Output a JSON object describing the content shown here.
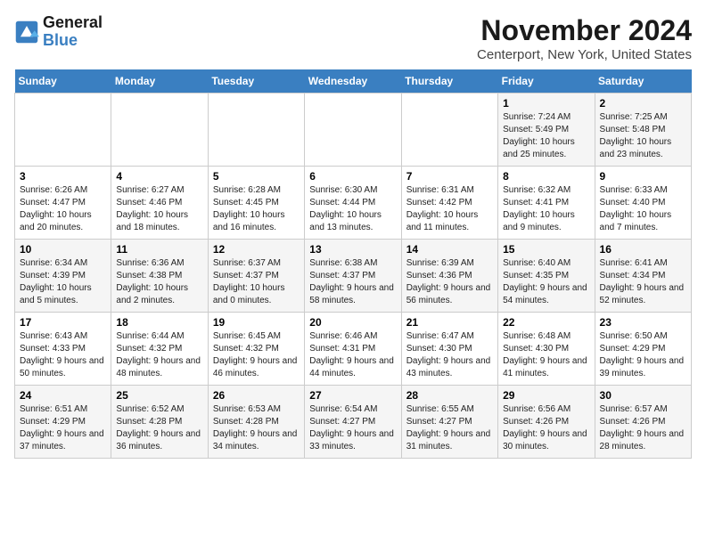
{
  "header": {
    "logo_line1": "General",
    "logo_line2": "Blue",
    "month": "November 2024",
    "location": "Centerport, New York, United States"
  },
  "weekdays": [
    "Sunday",
    "Monday",
    "Tuesday",
    "Wednesday",
    "Thursday",
    "Friday",
    "Saturday"
  ],
  "weeks": [
    [
      {
        "day": "",
        "info": ""
      },
      {
        "day": "",
        "info": ""
      },
      {
        "day": "",
        "info": ""
      },
      {
        "day": "",
        "info": ""
      },
      {
        "day": "",
        "info": ""
      },
      {
        "day": "1",
        "info": "Sunrise: 7:24 AM\nSunset: 5:49 PM\nDaylight: 10 hours and 25 minutes."
      },
      {
        "day": "2",
        "info": "Sunrise: 7:25 AM\nSunset: 5:48 PM\nDaylight: 10 hours and 23 minutes."
      }
    ],
    [
      {
        "day": "3",
        "info": "Sunrise: 6:26 AM\nSunset: 4:47 PM\nDaylight: 10 hours and 20 minutes."
      },
      {
        "day": "4",
        "info": "Sunrise: 6:27 AM\nSunset: 4:46 PM\nDaylight: 10 hours and 18 minutes."
      },
      {
        "day": "5",
        "info": "Sunrise: 6:28 AM\nSunset: 4:45 PM\nDaylight: 10 hours and 16 minutes."
      },
      {
        "day": "6",
        "info": "Sunrise: 6:30 AM\nSunset: 4:44 PM\nDaylight: 10 hours and 13 minutes."
      },
      {
        "day": "7",
        "info": "Sunrise: 6:31 AM\nSunset: 4:42 PM\nDaylight: 10 hours and 11 minutes."
      },
      {
        "day": "8",
        "info": "Sunrise: 6:32 AM\nSunset: 4:41 PM\nDaylight: 10 hours and 9 minutes."
      },
      {
        "day": "9",
        "info": "Sunrise: 6:33 AM\nSunset: 4:40 PM\nDaylight: 10 hours and 7 minutes."
      }
    ],
    [
      {
        "day": "10",
        "info": "Sunrise: 6:34 AM\nSunset: 4:39 PM\nDaylight: 10 hours and 5 minutes."
      },
      {
        "day": "11",
        "info": "Sunrise: 6:36 AM\nSunset: 4:38 PM\nDaylight: 10 hours and 2 minutes."
      },
      {
        "day": "12",
        "info": "Sunrise: 6:37 AM\nSunset: 4:37 PM\nDaylight: 10 hours and 0 minutes."
      },
      {
        "day": "13",
        "info": "Sunrise: 6:38 AM\nSunset: 4:37 PM\nDaylight: 9 hours and 58 minutes."
      },
      {
        "day": "14",
        "info": "Sunrise: 6:39 AM\nSunset: 4:36 PM\nDaylight: 9 hours and 56 minutes."
      },
      {
        "day": "15",
        "info": "Sunrise: 6:40 AM\nSunset: 4:35 PM\nDaylight: 9 hours and 54 minutes."
      },
      {
        "day": "16",
        "info": "Sunrise: 6:41 AM\nSunset: 4:34 PM\nDaylight: 9 hours and 52 minutes."
      }
    ],
    [
      {
        "day": "17",
        "info": "Sunrise: 6:43 AM\nSunset: 4:33 PM\nDaylight: 9 hours and 50 minutes."
      },
      {
        "day": "18",
        "info": "Sunrise: 6:44 AM\nSunset: 4:32 PM\nDaylight: 9 hours and 48 minutes."
      },
      {
        "day": "19",
        "info": "Sunrise: 6:45 AM\nSunset: 4:32 PM\nDaylight: 9 hours and 46 minutes."
      },
      {
        "day": "20",
        "info": "Sunrise: 6:46 AM\nSunset: 4:31 PM\nDaylight: 9 hours and 44 minutes."
      },
      {
        "day": "21",
        "info": "Sunrise: 6:47 AM\nSunset: 4:30 PM\nDaylight: 9 hours and 43 minutes."
      },
      {
        "day": "22",
        "info": "Sunrise: 6:48 AM\nSunset: 4:30 PM\nDaylight: 9 hours and 41 minutes."
      },
      {
        "day": "23",
        "info": "Sunrise: 6:50 AM\nSunset: 4:29 PM\nDaylight: 9 hours and 39 minutes."
      }
    ],
    [
      {
        "day": "24",
        "info": "Sunrise: 6:51 AM\nSunset: 4:29 PM\nDaylight: 9 hours and 37 minutes."
      },
      {
        "day": "25",
        "info": "Sunrise: 6:52 AM\nSunset: 4:28 PM\nDaylight: 9 hours and 36 minutes."
      },
      {
        "day": "26",
        "info": "Sunrise: 6:53 AM\nSunset: 4:28 PM\nDaylight: 9 hours and 34 minutes."
      },
      {
        "day": "27",
        "info": "Sunrise: 6:54 AM\nSunset: 4:27 PM\nDaylight: 9 hours and 33 minutes."
      },
      {
        "day": "28",
        "info": "Sunrise: 6:55 AM\nSunset: 4:27 PM\nDaylight: 9 hours and 31 minutes."
      },
      {
        "day": "29",
        "info": "Sunrise: 6:56 AM\nSunset: 4:26 PM\nDaylight: 9 hours and 30 minutes."
      },
      {
        "day": "30",
        "info": "Sunrise: 6:57 AM\nSunset: 4:26 PM\nDaylight: 9 hours and 28 minutes."
      }
    ]
  ]
}
